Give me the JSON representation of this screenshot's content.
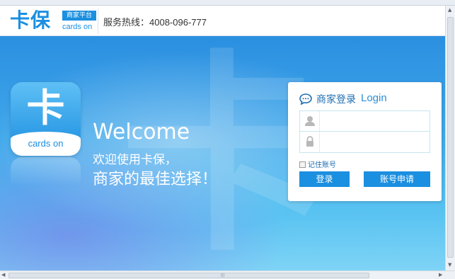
{
  "header": {
    "logo_main": "卡保",
    "logo_badge": "商家平台",
    "logo_sub": "cards on",
    "hotline": "服务热线：4008-096-777"
  },
  "banner": {
    "bg_char": "卡",
    "app_icon_char": "卡",
    "app_icon_text": "cards on",
    "welcome": "Welcome",
    "slogan_line1": "欢迎使用卡保，",
    "slogan_line2": "商家的最佳选择！"
  },
  "login": {
    "title": "商家登录",
    "title_en": "Login",
    "username_value": "",
    "password_value": "",
    "remember_label": "记住账号",
    "login_button": "登录",
    "apply_button": "账号申请"
  },
  "colors": {
    "brand": "#1b8fe0",
    "title_blue": "#1e6fb3",
    "field_border": "#c7e6ee"
  }
}
